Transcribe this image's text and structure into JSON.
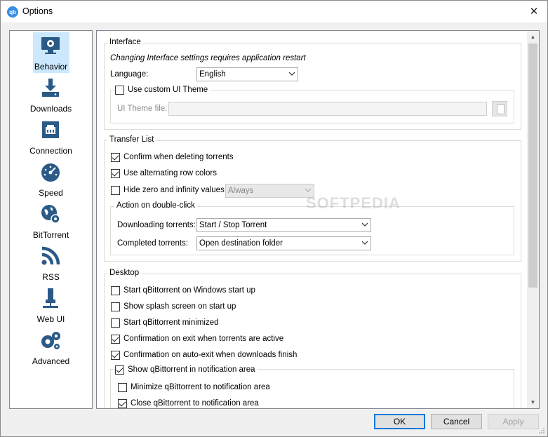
{
  "window": {
    "title": "Options",
    "app_icon_text": "qb"
  },
  "sidebar": {
    "items": [
      {
        "label": "Behavior",
        "icon": "monitor-gear-icon"
      },
      {
        "label": "Downloads",
        "icon": "download-tray-icon"
      },
      {
        "label": "Connection",
        "icon": "network-port-icon"
      },
      {
        "label": "Speed",
        "icon": "speedometer-icon"
      },
      {
        "label": "BitTorrent",
        "icon": "globe-gear-icon"
      },
      {
        "label": "RSS",
        "icon": "rss-icon"
      },
      {
        "label": "Web UI",
        "icon": "web-ui-plug-icon"
      },
      {
        "label": "Advanced",
        "icon": "gears-icon"
      }
    ]
  },
  "interface": {
    "title": "Interface",
    "restart_note": "Changing Interface settings requires application restart",
    "language_label": "Language:",
    "language_value": "English",
    "custom_theme_label": "Use custom UI Theme",
    "theme_file_label": "UI Theme file:",
    "theme_file_value": ""
  },
  "transfer_list": {
    "title": "Transfer List",
    "confirm_delete": "Confirm when deleting torrents",
    "alt_row_colors": "Use alternating row colors",
    "hide_zero": "Hide zero and infinity values",
    "hide_zero_mode": "Always",
    "double_click_title": "Action on double-click",
    "downloading_label": "Downloading torrents:",
    "downloading_value": "Start / Stop Torrent",
    "completed_label": "Completed torrents:",
    "completed_value": "Open destination folder"
  },
  "desktop": {
    "title": "Desktop",
    "start_on_startup": "Start qBittorrent on Windows start up",
    "splash": "Show splash screen on start up",
    "start_minimized": "Start qBittorrent minimized",
    "confirm_exit": "Confirmation on exit when torrents are active",
    "confirm_auto_exit": "Confirmation on auto-exit when downloads finish",
    "show_tray": "Show qBittorrent in notification area",
    "minimize_tray": "Minimize qBittorrent to notification area",
    "close_tray": "Close qBittorrent to notification area"
  },
  "buttons": {
    "ok": "OK",
    "cancel": "Cancel",
    "apply": "Apply"
  },
  "watermark": "SOFTPEDIA",
  "colors": {
    "selection": "#cce8ff",
    "default_button_border": "#0078d7",
    "icon_blue": "#2b5a87"
  }
}
